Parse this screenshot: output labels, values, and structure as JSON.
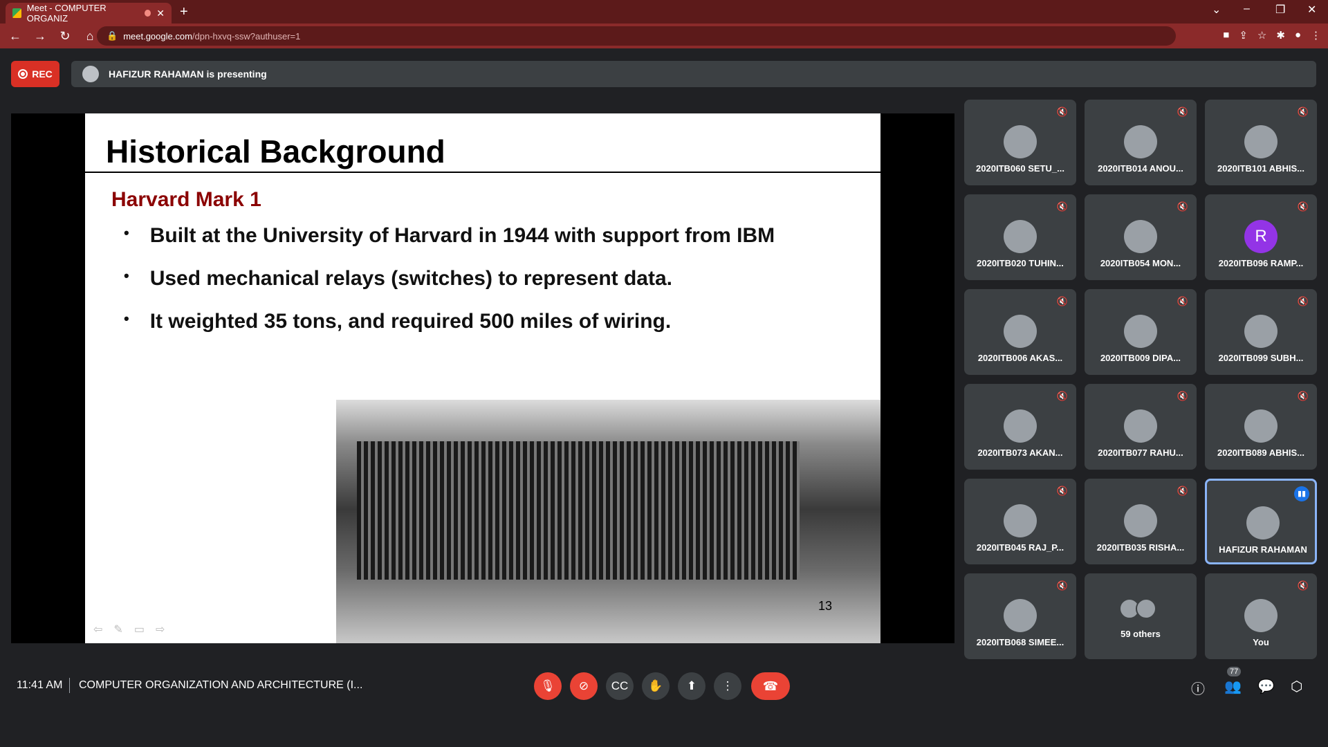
{
  "browser": {
    "tab_title": "Meet - COMPUTER ORGANIZ",
    "url_host": "meet.google.com",
    "url_path": "/dpn-hxvq-ssw?authuser=1"
  },
  "meet": {
    "rec_label": "REC",
    "presenting_text": "HAFIZUR RAHAMAN is presenting",
    "time": "11:41 AM",
    "meeting_title": "COMPUTER ORGANIZATION AND ARCHITECTURE (I...",
    "people_count": "77"
  },
  "slide": {
    "title": "Historical Background",
    "subtitle": "Harvard Mark 1",
    "bullets": [
      "Built at the University of Harvard in 1944 with support from IBM",
      "Used mechanical relays (switches) to represent data.",
      "It weighted 35 tons, and required 500 miles of wiring."
    ],
    "page_number": "13"
  },
  "participants": [
    "2020ITB060 SETU_...",
    "2020ITB014 ANOU...",
    "2020ITB101 ABHIS...",
    "2020ITB020 TUHIN...",
    "2020ITB054 MON...",
    "2020ITB096 RAMP...",
    "2020ITB006 AKAS...",
    "2020ITB009 DIPA...",
    "2020ITB099 SUBH...",
    "2020ITB073 AKAN...",
    "2020ITB077 RAHU...",
    "2020ITB089 ABHIS...",
    "2020ITB045 RAJ_P...",
    "2020ITB035 RISHA...",
    "HAFIZUR RAHAMAN",
    "2020ITB068 SIMEE...",
    "59 others",
    "You"
  ],
  "avatar_letter": "R",
  "colors": {
    "rec": "#d93025",
    "browser": "#8b2a2a",
    "meet_bg": "#202124",
    "tile": "#3c4043",
    "slide_subtitle": "#8b0000"
  }
}
